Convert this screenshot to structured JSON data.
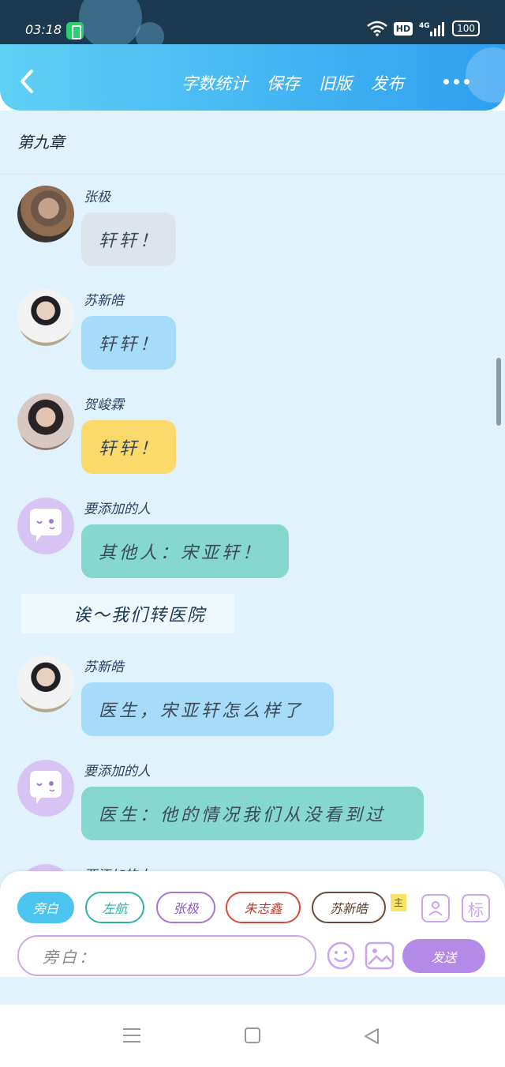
{
  "status_bar": {
    "time": "03:18",
    "hd": "HD",
    "network": "4G",
    "battery": "100"
  },
  "header": {
    "menu": [
      "字数统计",
      "保存",
      "旧版",
      "发布"
    ],
    "icons": [
      "back-arrow-icon",
      "more-dots-icon"
    ]
  },
  "chapter": {
    "title": "第九章"
  },
  "messages": [
    {
      "name": "张极",
      "text": "轩轩！",
      "avatar": "photo",
      "bubble_color": "#dde4ec"
    },
    {
      "name": "苏新皓",
      "text": "轩轩！",
      "avatar": "photo",
      "bubble_color": "#a6dcf9"
    },
    {
      "name": "贺峻霖",
      "text": "轩轩！",
      "avatar": "photo",
      "bubble_color": "#fbd96a"
    },
    {
      "name": "要添加的人",
      "text": "其他人：宋亚轩！",
      "avatar": "ghost",
      "bubble_color": "#86d7cd"
    },
    {
      "name": "苏新皓",
      "text": "医生，宋亚轩怎么样了",
      "avatar": "photo",
      "bubble_color": "#a6dcf9"
    },
    {
      "name": "要添加的人",
      "text": "医生：他的情况我们从没看到过",
      "avatar": "ghost",
      "bubble_color": "#86d7cd"
    }
  ],
  "narration": {
    "text": "诶～我们转医院"
  },
  "composer": {
    "roles": [
      "旁白",
      "左航",
      "张极",
      "朱志鑫",
      "苏新皓"
    ],
    "active_role": "旁白",
    "main_badge": "主",
    "input_value": "旁白：",
    "send_label": "发送",
    "tag_label": "标"
  },
  "colors": {
    "header_gradient_start": "#5fd0f5",
    "header_gradient_end": "#2f9ff0",
    "chat_background": "#e0f3fd",
    "send_button": "#b589e8"
  }
}
